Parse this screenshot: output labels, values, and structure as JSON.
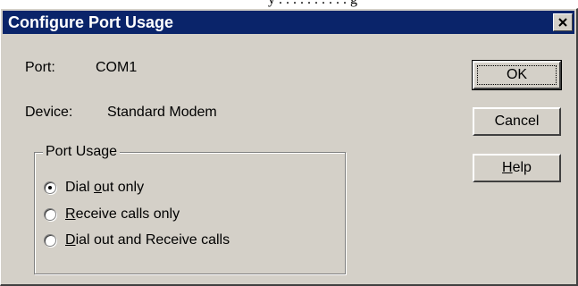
{
  "window": {
    "title": "Configure Port Usage",
    "close_glyph": "×"
  },
  "info": {
    "port_label": "Port:",
    "port_value": "COM1",
    "device_label": "Device:",
    "device_value": "Standard Modem"
  },
  "buttons": {
    "ok": "OK",
    "cancel": "Cancel",
    "help_access_key": "H",
    "help_rest": "elp"
  },
  "port_usage": {
    "legend": "Port Usage",
    "selected_index": 0,
    "options": [
      {
        "access_key": "o",
        "before": "Dial ",
        "after": "ut only",
        "checked": true
      },
      {
        "access_key": "R",
        "before": "",
        "after": "eceive calls only",
        "checked": false
      },
      {
        "access_key": "D",
        "before": "",
        "after": "ial out and Receive calls",
        "checked": false
      }
    ]
  },
  "colors": {
    "titlebar": "#0a246a",
    "face": "#d4d0c8"
  }
}
